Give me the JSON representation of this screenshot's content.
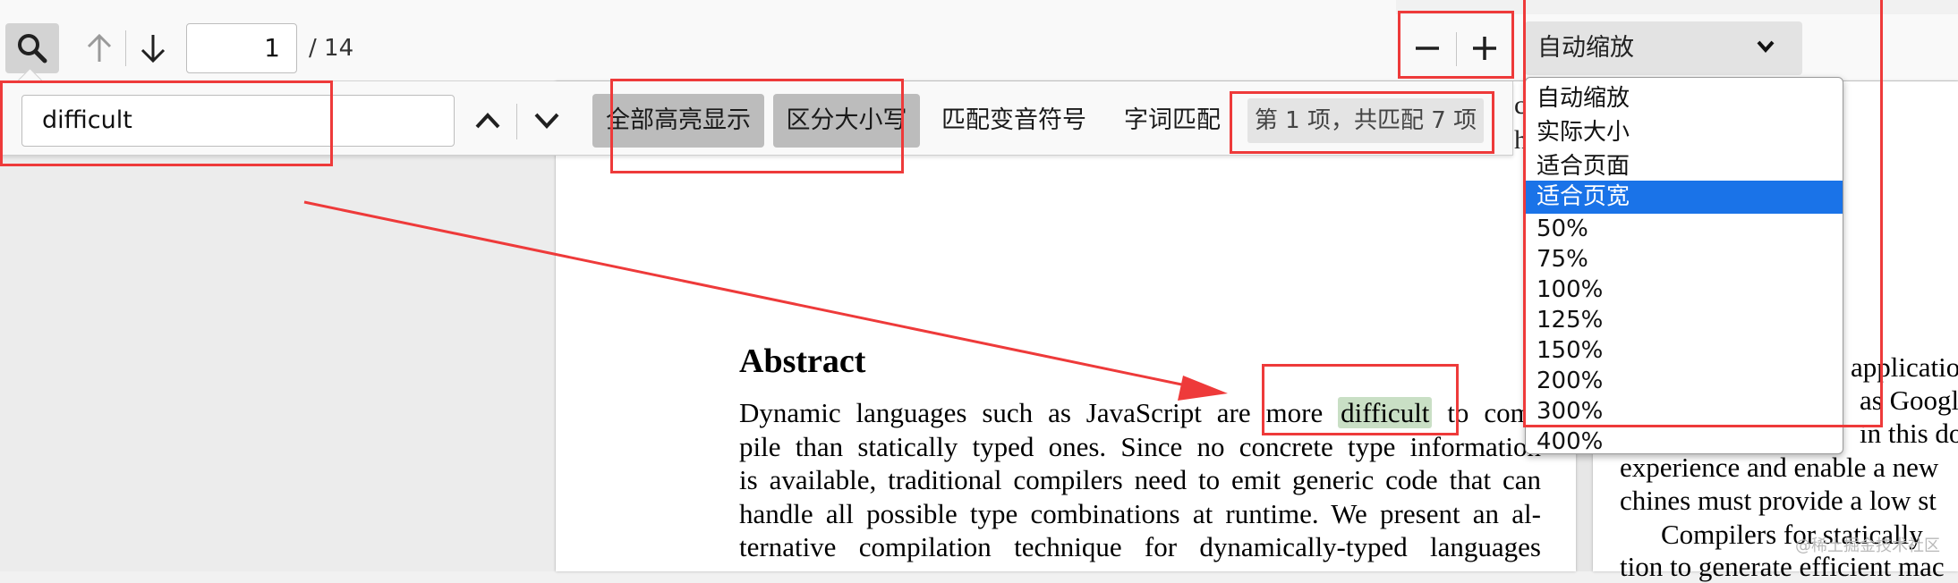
{
  "toolbar": {
    "page_number_value": "1",
    "page_count": "/ 14",
    "zoom_selected": "自动缩放"
  },
  "findbar": {
    "query_value": "difficult",
    "highlight_all_label": "全部高亮显示",
    "match_case_label": "区分大小写",
    "match_diacritics_label": "匹配变音符号",
    "whole_words_label": "字词匹配",
    "result_text": "第 1 项，共匹配 7 项"
  },
  "zoom_options": {
    "items": [
      {
        "label": "自动缩放",
        "selected": false
      },
      {
        "label": "实际大小",
        "selected": false
      },
      {
        "label": "适合页面",
        "selected": false
      },
      {
        "label": "适合页宽",
        "selected": true
      },
      {
        "label": "50%",
        "selected": false
      },
      {
        "label": "75%",
        "selected": false
      },
      {
        "label": "100%",
        "selected": false
      },
      {
        "label": "125%",
        "selected": false
      },
      {
        "label": "150%",
        "selected": false
      },
      {
        "label": "200%",
        "selected": false
      },
      {
        "label": "300%",
        "selected": false
      },
      {
        "label": "400%",
        "selected": false
      }
    ]
  },
  "document": {
    "abstract_heading": "Abstract",
    "line1_before": "Dynamic languages such as JavaScript are more",
    "line1_match": "difficult",
    "line1_after": "to com-",
    "lines": [
      "pile than statically typed ones. Since no concrete type information",
      "is available, traditional compilers need to emit generic code that can",
      "handle all possible type combinations at runtime. We present an al-",
      "ternative compilation technique for dynamically-typed languages"
    ],
    "right_column": {
      "line1": "applicatio",
      "line2": "as Google",
      "line3": "in this do",
      "line4": "experience and enable a new",
      "line5": "chines must provide a low st",
      "line6": "Compilers for statically",
      "line7": "tion to generate efficient mac"
    },
    "edge_fragments": [
      "c",
      "h"
    ]
  },
  "watermark": "@稀土掘金技术社区",
  "colors": {
    "annotation_red": "#ee3a3a",
    "match_highlight": "#c9dfc5",
    "selected_option": "#1a73e8"
  }
}
